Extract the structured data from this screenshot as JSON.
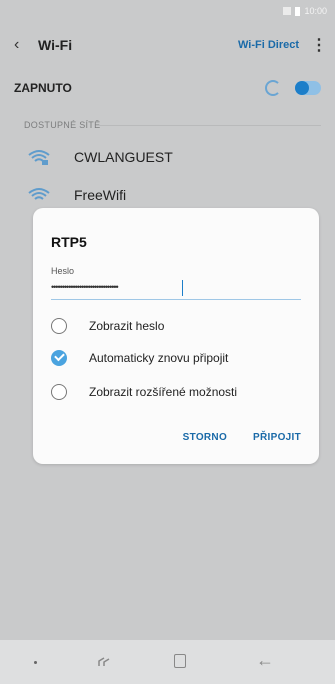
{
  "status": {
    "time": "10:00"
  },
  "header": {
    "title": "Wi-Fi",
    "back_icon": "back-arrow-icon",
    "wifi_direct": "Wi-Fi Direct",
    "more_icon": "more-vert-icon"
  },
  "onrow": {
    "label": "ZAPNUTO",
    "toggle_state": "on"
  },
  "networks": {
    "section_title": "DOSTUPNÉ SÍTĚ",
    "items": [
      {
        "name": "CWLANGUEST",
        "secured": true
      },
      {
        "name": "FreeWifi",
        "secured": false
      }
    ]
  },
  "dialog": {
    "title": "RTP5",
    "password_label": "Heslo",
    "password_value": "•••••••••••••••••••••••••••••••",
    "options": [
      {
        "label": "Zobrazit heslo",
        "checked": false
      },
      {
        "label": "Automaticky znovu připojit",
        "checked": true
      },
      {
        "label": "Zobrazit rozšířené možnosti",
        "checked": false
      }
    ],
    "cancel": "STORNO",
    "connect": "PŘIPOJIT"
  },
  "colors": {
    "accent": "#1a6aa8",
    "check": "#4aa3df",
    "scrim": "#cbcccd"
  }
}
